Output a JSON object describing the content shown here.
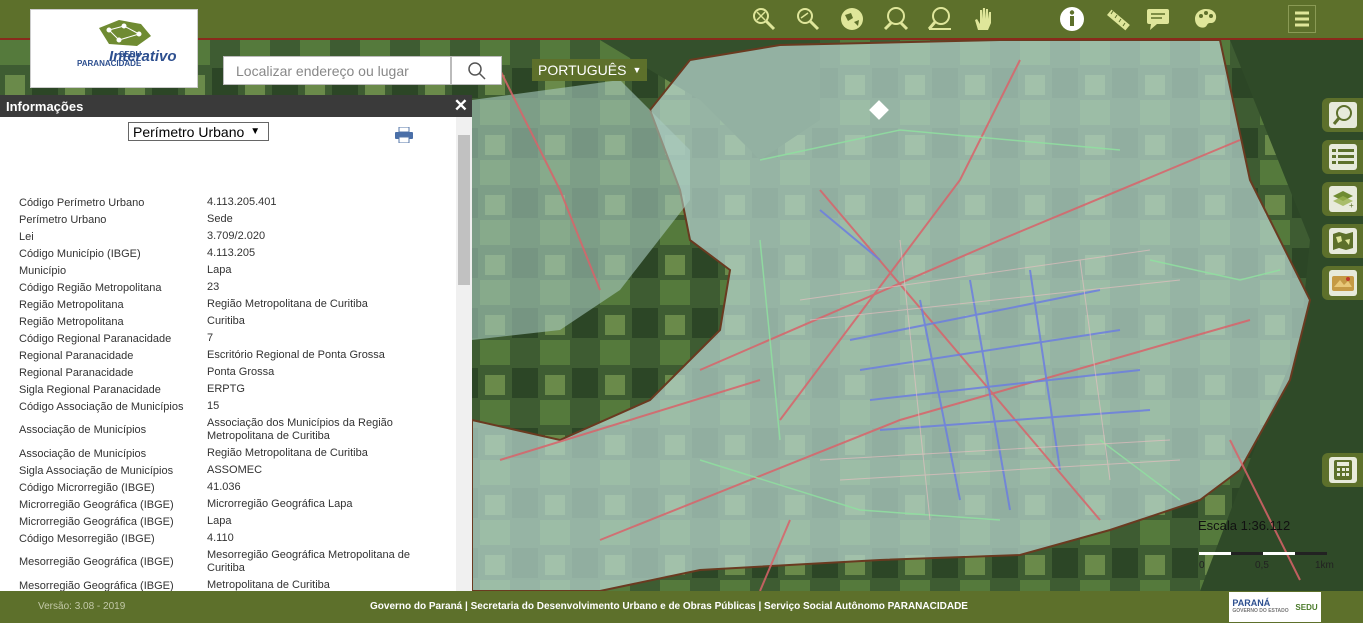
{
  "logo": {
    "sedu": "SEDU",
    "paranacidade": "PARANACIDADE",
    "interativo": "Interativo"
  },
  "toolbar": {
    "tools": [
      {
        "name": "zoom-box-icon"
      },
      {
        "name": "zoom-icon"
      },
      {
        "name": "globe-icon"
      },
      {
        "name": "zoom-in-icon"
      },
      {
        "name": "zoom-out-icon"
      },
      {
        "name": "hand-pan-icon"
      },
      {
        "name": "info-icon"
      },
      {
        "name": "ruler-icon"
      },
      {
        "name": "chat-icon"
      },
      {
        "name": "palette-icon"
      },
      {
        "name": "menu-icon"
      }
    ]
  },
  "search": {
    "placeholder": "Localizar endereço ou lugar"
  },
  "language": {
    "label": "PORTUGUÊS"
  },
  "panel": {
    "title": "Informações",
    "close": "✕",
    "select_value": "Perímetro Urbano",
    "rows": [
      {
        "k": "Código Perímetro Urbano",
        "v": "4.113.205.401"
      },
      {
        "k": "Perímetro Urbano",
        "v": "Sede"
      },
      {
        "k": "Lei",
        "v": "3.709/2.020"
      },
      {
        "k": "Código Município (IBGE)",
        "v": "4.113.205"
      },
      {
        "k": "Município",
        "v": "Lapa"
      },
      {
        "k": "Código Região Metropolitana",
        "v": "23"
      },
      {
        "k": "Região Metropolitana",
        "v": "Região Metropolitana de Curitiba"
      },
      {
        "k": "Região Metropolitana",
        "v": "Curitiba"
      },
      {
        "k": "Código Regional Paranacidade",
        "v": "7"
      },
      {
        "k": "Regional Paranacidade",
        "v": "Escritório Regional de Ponta Grossa"
      },
      {
        "k": "Regional Paranacidade",
        "v": "Ponta Grossa"
      },
      {
        "k": "Sigla Regional Paranacidade",
        "v": "ERPTG"
      },
      {
        "k": "Código Associação de Municípios",
        "v": "15"
      },
      {
        "k": "Associação de Municípios",
        "v": "Associação dos Municípios da Região Metropolitana de Curitiba"
      },
      {
        "k": "Associação de Municípios",
        "v": "Região Metropolitana de Curitiba"
      },
      {
        "k": "Sigla Associação de Municípios",
        "v": "ASSOMEC"
      },
      {
        "k": "Código Microrregião (IBGE)",
        "v": "41.036"
      },
      {
        "k": "Microrregião Geográfica (IBGE)",
        "v": "Microrregião Geográfica Lapa"
      },
      {
        "k": "Microrregião Geográfica (IBGE)",
        "v": "Lapa"
      },
      {
        "k": "Código Mesorregião (IBGE)",
        "v": "4.110"
      },
      {
        "k": "Mesorregião Geográfica (IBGE)",
        "v": "Mesorregião Geográfica Metropolitana de Curitiba"
      },
      {
        "k": "Mesorregião Geográfica (IBGE)",
        "v": "Metropolitana de Curitiba"
      }
    ]
  },
  "right_buttons": [
    {
      "name": "search-map-icon"
    },
    {
      "name": "list-icon"
    },
    {
      "name": "layers-icon"
    },
    {
      "name": "map-icon"
    },
    {
      "name": "basemap-icon"
    },
    {
      "name": "calculator-icon"
    }
  ],
  "scale": {
    "label": "Escala 1:36.112",
    "ticks": [
      "0",
      "0,5",
      "1km"
    ]
  },
  "footer": {
    "version": "Versão: 3.08 - 2019",
    "credits": "Governo do Paraná | Secretaria do Desenvolvimento Urbano e de Obras Públicas | Serviço Social Autônomo PARANACIDADE",
    "logo_parana": "PARANÁ",
    "logo_gov": "GOVERNO DO ESTADO",
    "logo_sedu": "SEDU"
  },
  "colors": {
    "brand": "#5d702b",
    "panel_head": "#3a3a3a",
    "boundary": "#8a2a1c"
  }
}
